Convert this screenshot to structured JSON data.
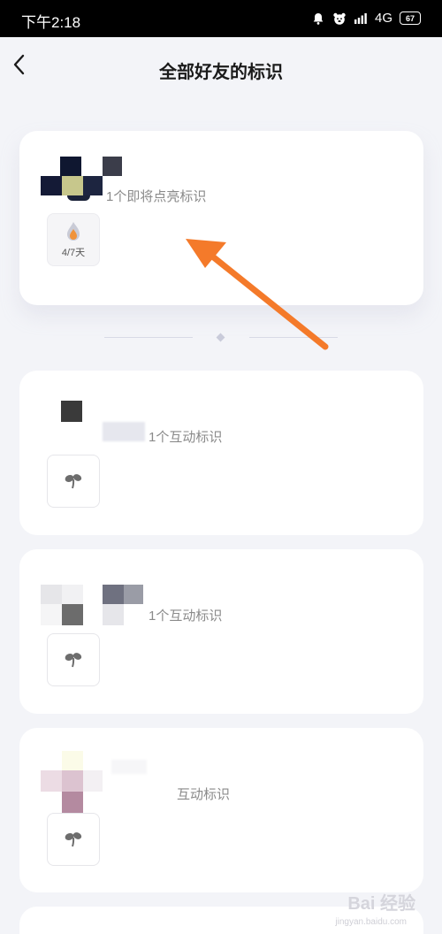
{
  "status_bar": {
    "time": "下午2:18",
    "network": "4G",
    "battery": "67"
  },
  "header": {
    "title": "全部好友的标识"
  },
  "friends": [
    {
      "text": "1个即将点亮标识",
      "badge_label": "4/7天",
      "badge_icon": "flame-icon"
    },
    {
      "text": "1个互动标识",
      "badge_icon": "sprout-icon"
    },
    {
      "text": "1个互动标识",
      "badge_icon": "sprout-icon"
    },
    {
      "text": "互动标识",
      "badge_icon": "sprout-icon"
    }
  ],
  "watermark": {
    "brand": "Bai 经验",
    "url": "jingyan.baidu.com"
  },
  "colors": {
    "accent_arrow": "#f47a2a",
    "background": "#f3f4f8",
    "card": "#ffffff"
  }
}
